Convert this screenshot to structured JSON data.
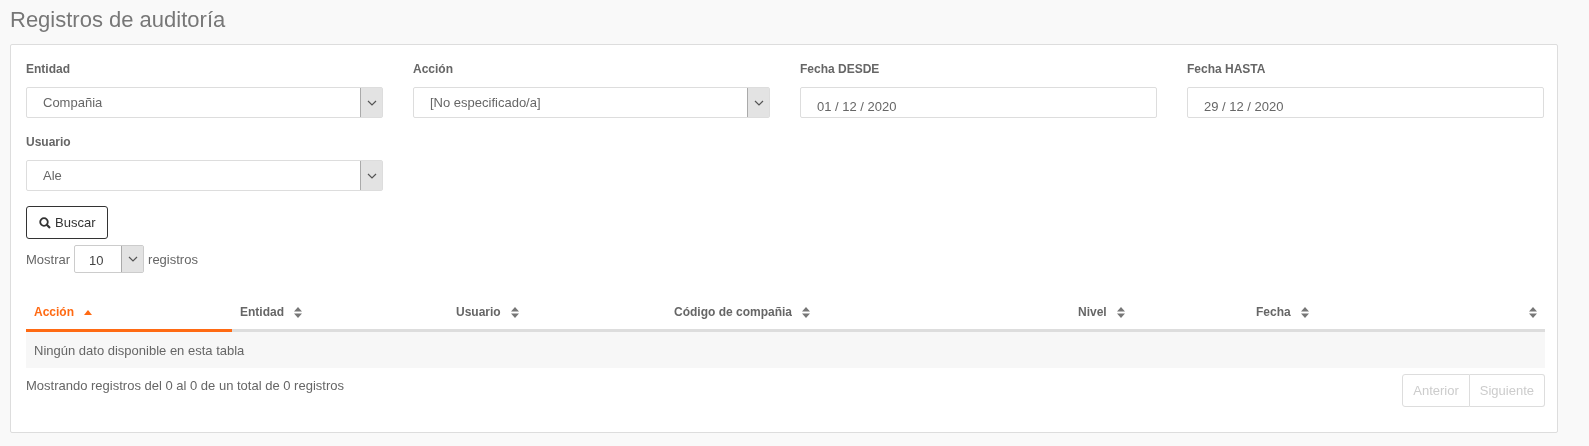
{
  "page_title": "Registros de auditoría",
  "filters": [
    {
      "kind": "select",
      "label": "Entidad",
      "value": "Compañia"
    },
    {
      "kind": "select",
      "label": "Acción",
      "value": "[No especificado/a]"
    },
    {
      "kind": "date",
      "label": "Fecha DESDE",
      "value": "01 / 12 / 2020"
    },
    {
      "kind": "date",
      "label": "Fecha HASTA",
      "value": "29 / 12 / 2020"
    },
    {
      "kind": "select",
      "label": "Usuario",
      "value": "Ale"
    }
  ],
  "search_button": "Buscar",
  "page_length": {
    "prefix": "Mostrar",
    "value": "10",
    "suffix": "registros"
  },
  "table": {
    "columns": [
      {
        "label": "Acción",
        "sorted": true
      },
      {
        "label": "Entidad",
        "sorted": false
      },
      {
        "label": "Usuario",
        "sorted": false
      },
      {
        "label": "Código de compañia",
        "sorted": false
      },
      {
        "label": "Nivel",
        "sorted": false
      },
      {
        "label": "Fecha",
        "sorted": false
      },
      {
        "sorted": false
      }
    ],
    "empty_message": "Ningún dato disponible en esta tabla"
  },
  "info": "Mostrando registros del 0 al 0 de un total de 0 registros",
  "pagination": [
    {
      "label": "Anterior",
      "disabled": true
    },
    {
      "label": "Siguiente",
      "disabled": true
    }
  ]
}
